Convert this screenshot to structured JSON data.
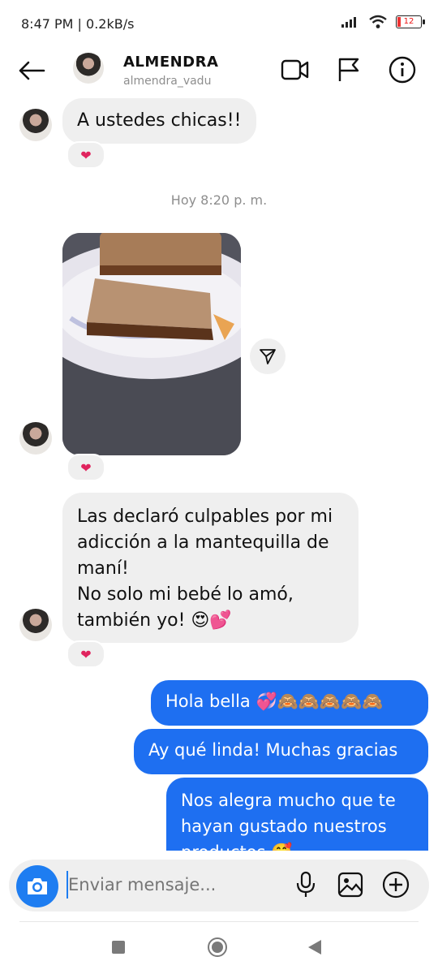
{
  "status_bar": {
    "time": "8:47 PM | 0.2kB/s",
    "battery": "12"
  },
  "header": {
    "title": "ALMENDRA",
    "subtitle": "almendra_vadu",
    "icons": [
      "back-arrow-icon",
      "video-call-icon",
      "flag-icon",
      "info-icon"
    ]
  },
  "messages": {
    "m1": "A ustedes chicas!!",
    "timestamp": "Hoy 8:20 p. m.",
    "m3_lines": [
      "Las declaró culpables por mi",
      "adicción a la mantequilla de",
      "maní!",
      "No solo mi bebé lo amó,",
      "también yo! 😍💕"
    ],
    "reaction": "❤",
    "out1": "Hola bella 💞🙈🙈🙈🙈🙈",
    "out2": "Ay qué linda! Muchas gracias",
    "out3_lines": [
      "Nos alegra mucho que te",
      "hayan gustado nuestros",
      "productos 🥰"
    ]
  },
  "composer": {
    "placeholder": "Enviar mensaje..."
  },
  "colors": {
    "accent": "#1e6ff1",
    "incoming": "#efefef",
    "reaction": "#e0245e"
  }
}
